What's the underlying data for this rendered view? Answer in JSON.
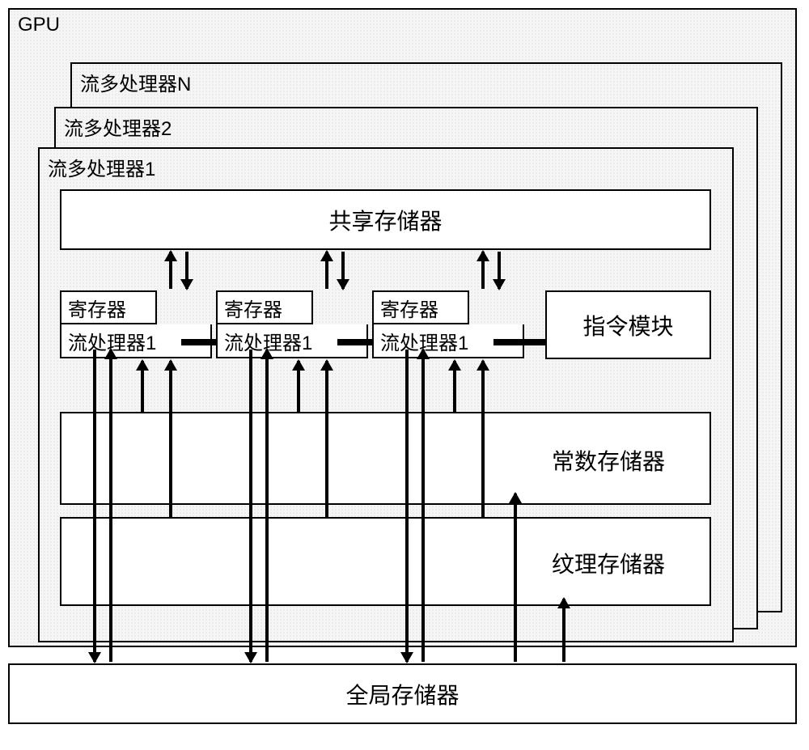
{
  "gpu": {
    "label": "GPU",
    "smp_n": "流多处理器N",
    "smp_2": "流多处理器2",
    "smp_1": {
      "label": "流多处理器1",
      "shared_memory": "共享存储器",
      "register": "寄存器",
      "stream_processor": "流处理器1",
      "instruction_module": "指令模块",
      "constant_memory": "常数存储器",
      "texture_memory": "纹理存储器"
    }
  },
  "global_memory": "全局存储器"
}
